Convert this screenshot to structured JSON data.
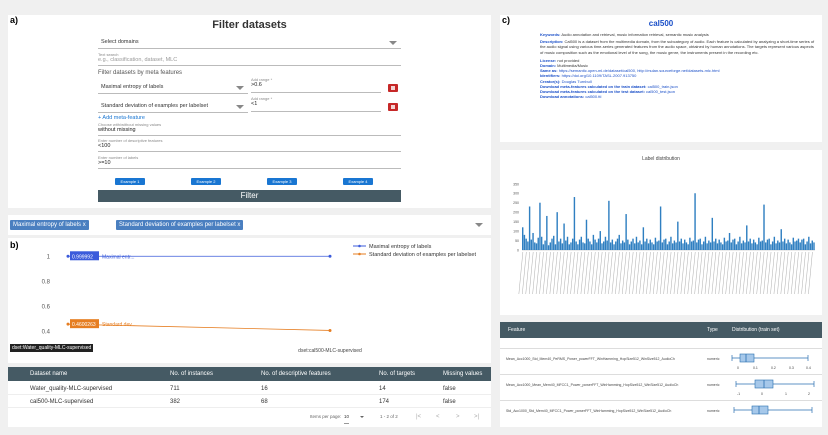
{
  "panel_labels": {
    "a": "a)",
    "b": "b)",
    "c": "c)"
  },
  "filter": {
    "title": "Filter datasets",
    "domains_placeholder": "Select domains",
    "search_label": "Text search",
    "search_placeholder": "e.g., classification, dataset, MLC",
    "meta_heading": "Filter datasets by meta features",
    "rows": [
      {
        "feature": "Maximal entropy of labels",
        "range_label": "Add range *",
        "range_value": ">0.6"
      },
      {
        "feature": "Standard deviation of examples per labelset",
        "range_label": "Add range *",
        "range_value": "<1"
      }
    ],
    "add_meta_label": "+ Add meta-feature",
    "missing_label": "Choose with/without missing values",
    "missing_value": "without missing",
    "desc_label": "Enter number of descriptive features",
    "desc_value": "<100",
    "labels_label": "Enter number of labels",
    "labels_value": ">=10",
    "examples": [
      "Example 1",
      "Example 2",
      "Example 3",
      "Example 4"
    ],
    "filter_button": "Filter"
  },
  "chips": [
    "Maximal entropy of labels x",
    "Standard deviation of examples per labelset x"
  ],
  "plot": {
    "chart_data": {
      "type": "line",
      "y_ticks": [
        "1",
        "0.8",
        "0.6",
        "0.4"
      ],
      "ylim": [
        0.35,
        1.05
      ],
      "series": [
        {
          "name": "Maximal entropy of labels",
          "color": "#3b5bdb",
          "values": [
            0.999999,
            1.0
          ],
          "label_value": "0.999992",
          "label_text": "Maximal entr..."
        },
        {
          "name": "Standard deviation of examples per labelset",
          "color": "#e67e22",
          "values": [
            0.4600263,
            0.41
          ],
          "label_value": "0.4600263",
          "label_text": "Standard dev..."
        }
      ],
      "categories": [
        "dset:Water_quality-MLC-supervised",
        "dset:cal500-MLC-supervised"
      ]
    }
  },
  "table": {
    "headers": [
      "Dataset name",
      "No. of instances",
      "No. of descriptive features",
      "No. of targets",
      "Missing values"
    ],
    "rows": [
      [
        "Water_quality-MLC-supervised",
        "711",
        "16",
        "14",
        "false"
      ],
      [
        "cal500-MLC-supervised",
        "382",
        "68",
        "174",
        "false"
      ]
    ],
    "items_per_page_label": "Items per page:",
    "items_per_page": "10",
    "range": "1 - 2 of 2",
    "pager": [
      "|<",
      "<",
      ">",
      ">|"
    ]
  },
  "dataset": {
    "name": "cal500",
    "keywords_label": "Keywords:",
    "keywords": "Audio annotation and retrieval, music information retrieval, semantic music analysis",
    "description_label": "Description:",
    "description": "Cal500 is a dataset from the multimedia domain, from the subcategory of audio. Each feature is calculated by analyzing a short-time series of the audio signal using various time-series generated features from the audio space, obtained by human annotations. The targets represent various aspects of music composition such as the emotional level of the song, the music genre, the instruments present in the recording etc.",
    "license_label": "License:",
    "license": "not provided",
    "domain_label": "Domain:",
    "domain": "Multimedia/Music",
    "sameas_label": "Same as:",
    "sameas": "https://semantic.open-ml.de/dataset/cal500, http://mulan.sourceforge.net/datasets-mlc.html",
    "identifiers_label": "Identifiers:",
    "identifiers": "https://doi.org/10.1109/TASL.2007.913750",
    "creators_label": "Creator(s):",
    "creators": "Douglas Turnbull",
    "train_label": "Download meta-features calculated on the train dataset:",
    "train_link": "cal500_train.json",
    "test_label": "Download meta-features calculated on the test dataset:",
    "test_link": "cal500_test.json",
    "annot_label": "Download annotations:",
    "annot_link": "cal500.ttl"
  },
  "label_dist": {
    "title": "Label distribution",
    "chart_data": {
      "type": "bar",
      "y_ticks": [
        "350",
        "300",
        "250",
        "200",
        "150",
        "100",
        "50",
        "0"
      ],
      "ylim": [
        0,
        370
      ],
      "values": [
        120,
        80,
        60,
        45,
        230,
        55,
        90,
        40,
        35,
        65,
        250,
        70,
        30,
        50,
        180,
        25,
        40,
        60,
        75,
        30,
        200,
        45,
        60,
        35,
        140,
        50,
        70,
        30,
        40,
        60,
        280,
        45,
        30,
        55,
        70,
        40,
        35,
        160,
        60,
        45,
        30,
        80,
        55,
        40,
        60,
        100,
        35,
        45,
        70,
        50,
        260,
        40,
        55,
        30,
        45,
        60,
        80,
        35,
        50,
        40,
        190,
        55,
        30,
        45,
        60,
        35,
        70,
        40,
        50,
        30,
        120,
        45,
        60,
        35,
        55,
        40,
        30,
        65,
        45,
        50,
        230,
        40,
        55,
        60,
        30,
        45,
        70,
        35,
        50,
        40,
        150,
        45,
        60,
        35,
        55,
        40,
        30,
        65,
        45,
        50,
        300,
        40,
        55,
        60,
        30,
        45,
        70,
        35,
        50,
        40,
        170,
        45,
        60,
        35,
        55,
        40,
        30,
        65,
        45,
        50,
        90,
        40,
        55,
        60,
        30,
        45,
        70,
        35,
        50,
        40,
        130,
        45,
        60,
        35,
        55,
        40,
        30,
        65,
        45,
        50,
        240,
        40,
        55,
        60,
        30,
        45,
        70,
        35,
        50,
        40,
        110,
        45,
        60,
        35,
        55,
        40,
        30,
        65,
        45,
        50,
        60,
        40,
        55,
        60,
        30,
        45,
        70,
        35,
        50,
        40
      ]
    }
  },
  "features_table": {
    "headers": [
      "Feature",
      "Type",
      "Distribution (train set)"
    ],
    "rows": [
      {
        "name": "Mean_Acc1000_Std_Mem40_PeRMS_Power_powerFFT_WinHamming_HopSize512_WinSize512_AudioCh",
        "type": "numeric",
        "ticks": [
          "0",
          "0.1",
          "0.2",
          "0.3",
          "0.4"
        ]
      },
      {
        "name": "Mean_Acc1000_Mean_Mem40_MFCC1_Power_powerFFT_WinHamming_HopSize512_WinSize512_AudioCh",
        "type": "numeric",
        "ticks": [
          "-1",
          "0",
          "1",
          "2"
        ]
      },
      {
        "name": "Std_Acc1000_Std_Mem40_MFCC1_Power_powerFFT_WinHamming_HopSize512_WinSize512_AudioCh",
        "type": "numeric",
        "ticks": []
      }
    ]
  }
}
